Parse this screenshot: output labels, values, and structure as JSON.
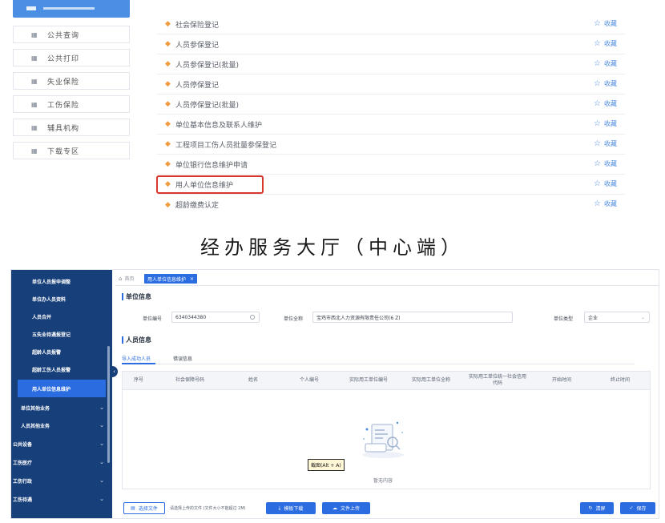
{
  "top": {
    "left_nav": [
      {
        "icon": "grid-icon",
        "label": "公共查询"
      },
      {
        "icon": "grid-icon",
        "label": "公共打印"
      },
      {
        "icon": "grid-icon",
        "label": "失业保险"
      },
      {
        "icon": "grid-icon",
        "label": "工伤保险"
      },
      {
        "icon": "grid-icon",
        "label": "辅具机构"
      },
      {
        "icon": "grid-icon",
        "label": "下载专区"
      }
    ],
    "services": [
      "社会保险登记",
      "人员参保登记",
      "人员参保登记(批量)",
      "人员停保登记",
      "人员停保登记(批量)",
      "单位基本信息及联系人维护",
      "工程项目工伤人员批量参保登记",
      "单位银行信息维护申请",
      "用人单位信息维护",
      "超龄缴费认定"
    ],
    "favorite_label": "收藏",
    "highlighted_index": 8
  },
  "caption": "经办服务大厅（中心端）",
  "app": {
    "sidebar": [
      {
        "label": "单位人员报申调整",
        "level": 2
      },
      {
        "label": "单位办人员资料",
        "level": 2
      },
      {
        "label": "人员合并",
        "level": 2
      },
      {
        "label": "五失业待遇报登记",
        "level": 2
      },
      {
        "label": "超龄人员报警",
        "level": 2
      },
      {
        "label": "超龄工伤人员报警",
        "level": 2
      },
      {
        "label": "用人单位信息维护",
        "level": 2,
        "active": true
      },
      {
        "label": "单位其他业务",
        "level": 1,
        "chevron": true
      },
      {
        "label": "人员其他业务",
        "level": 1,
        "chevron": true
      },
      {
        "label": "公共设备",
        "level": 0,
        "chevron": true
      },
      {
        "label": "工伤医疗",
        "level": 0,
        "chevron": true
      },
      {
        "label": "工伤行政",
        "level": 0,
        "chevron": true
      },
      {
        "label": "工伤待遇",
        "level": 0,
        "chevron": true
      }
    ],
    "tabs": {
      "home": "首页",
      "active": "用人单位信息维护"
    },
    "unit_section": {
      "title": "单位信息",
      "code_label": "单位编号",
      "code_value": "6340344380",
      "name_label": "单位全称",
      "name_value": "宝鸡市西北人力资源有限责任公司(6 Z)",
      "type_label": "单位类型",
      "type_value": "企业"
    },
    "staff_section": {
      "title": "人员信息",
      "subtabs": [
        "导入成功人员",
        "错误信息"
      ],
      "columns": [
        "序号",
        "社会保障号码",
        "姓名",
        "个人编号",
        "实际用工单位编号",
        "实际用工单位全称",
        "实际用工单位统一社会信用代码",
        "开始时间",
        "终止时间"
      ],
      "empty_text": "暂无内容"
    },
    "screenshot_tag": "截图(Alt + A)",
    "footer": {
      "choose_file": "选择文件",
      "hint": "请选择上传的文件 (文件大小不能超过 2M)",
      "download_template": "模板下载",
      "upload_file": "文件上传",
      "reset": "清屏",
      "save": "保存"
    },
    "colors": {
      "sidebar_bg": "#173f7a",
      "accent": "#2b6de0",
      "highlight_border": "#d8372e",
      "favorite": "#4d8be0",
      "service_dot": "#f19a3e"
    }
  }
}
